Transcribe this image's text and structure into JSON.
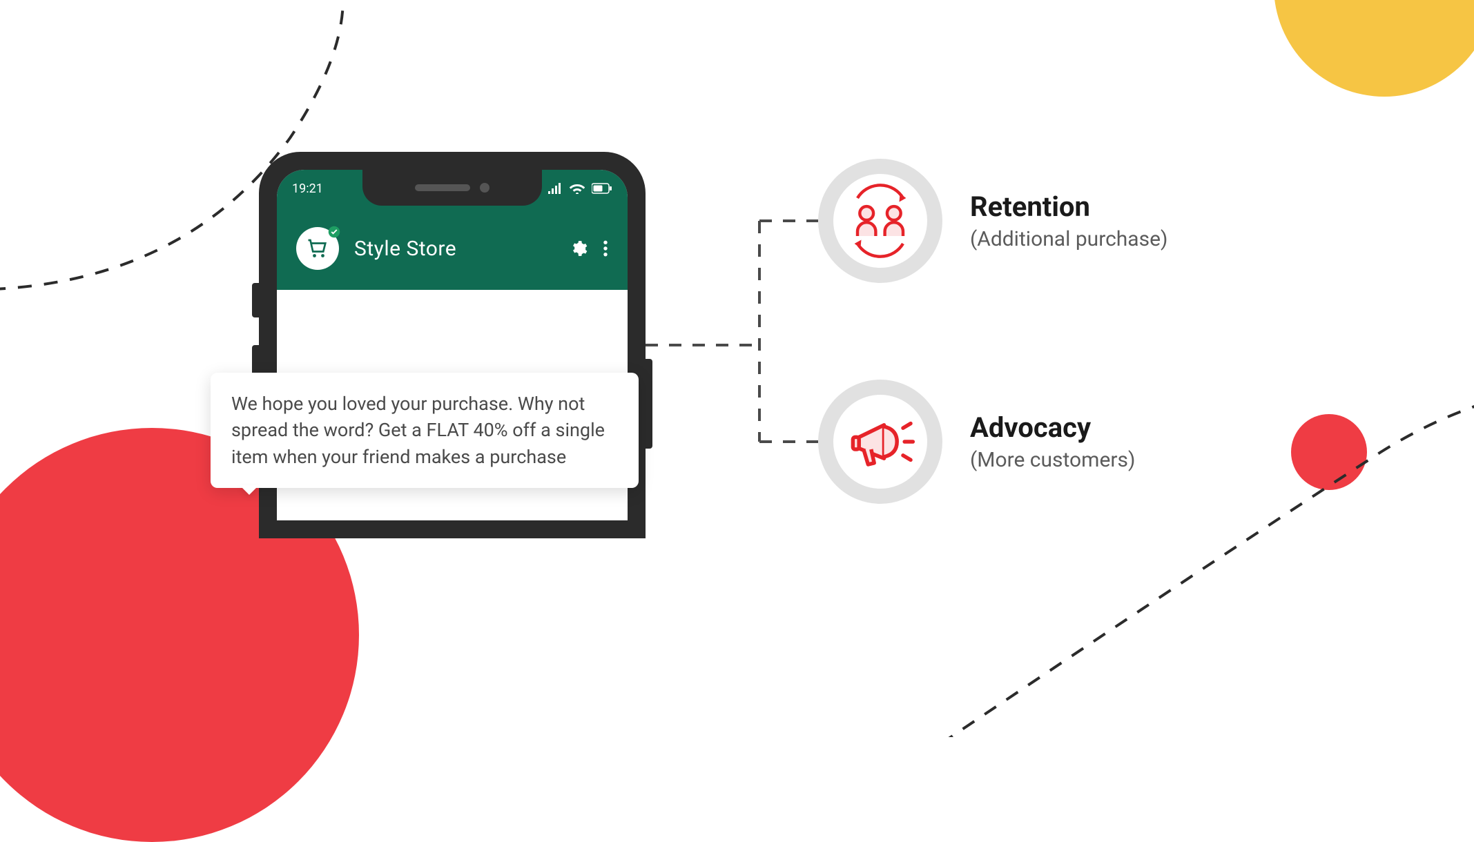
{
  "phone": {
    "status": {
      "time": "19:21"
    },
    "app": {
      "title": "Style Store"
    }
  },
  "chat": {
    "message": "We hope you loved your purchase. Why not spread the word? Get a FLAT 40% off a single item when your friend makes a purchase"
  },
  "results": {
    "retention": {
      "title": "Retention",
      "subtitle": "(Additional purchase)"
    },
    "advocacy": {
      "title": "Advocacy",
      "subtitle": "(More customers)"
    }
  }
}
